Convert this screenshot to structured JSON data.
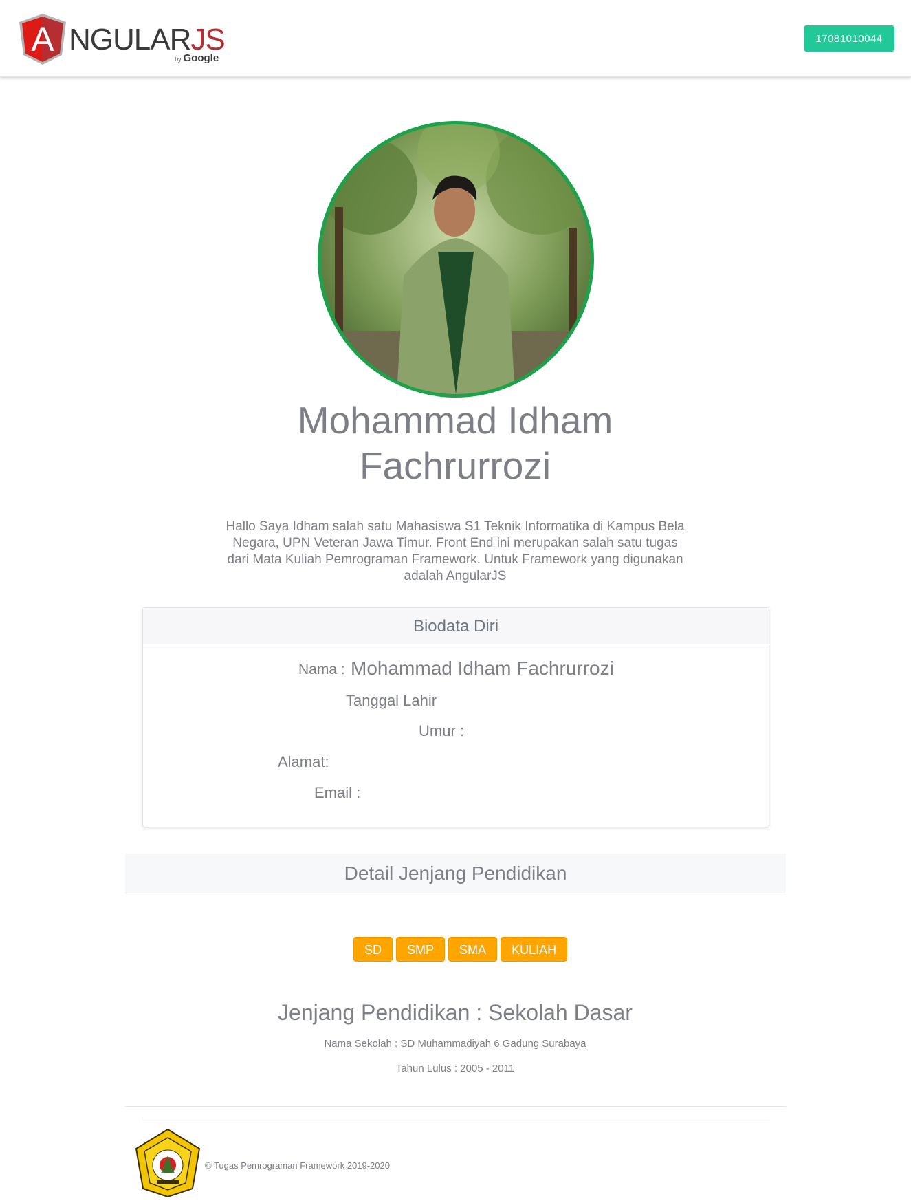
{
  "navbar": {
    "logo": {
      "wordmark": "NGULARJS",
      "by": "by",
      "google": "Google",
      "shield_letter": "A"
    },
    "nim_button_label": "17081010044"
  },
  "profile": {
    "name_line1": "Mohammad Idham",
    "name_line2": "Fachrurrozi",
    "intro": "Hallo Saya Idham salah satu Mahasiswa S1 Teknik Informatika di Kampus Bela Negara, UPN Veteran Jawa Timur. Front End ini merupakan salah satu tugas dari Mata Kuliah Pemrograman Framework. Untuk Framework yang digunakan adalah AngularJS"
  },
  "biodata": {
    "title": "Biodata Diri",
    "name_label": "Nama :",
    "name_value": "Mohammad Idham Fachrurrozi",
    "birth_label": "Tanggal Lahir",
    "age_label": "Umur :",
    "address_label": "Alamat:",
    "email_label": "Email :"
  },
  "education": {
    "header": "Detail Jenjang Pendidikan",
    "tabs": [
      "SD",
      "SMP",
      "SMA",
      "KULIAH"
    ],
    "title": "Jenjang Pendidikan : Sekolah Dasar",
    "school": "Nama Sekolah : SD Muhammadiyah 6 Gadung Surabaya",
    "year": "Tahun Lulus : 2005 - 2011"
  },
  "footer": {
    "text": "© Tugas Pemrograman Framework 2019-2020"
  },
  "colors": {
    "accent_green": "#20c997",
    "avatar_border": "#1aa34a",
    "tab_orange": "#ffa500",
    "angular_red": "#dd1b16"
  }
}
